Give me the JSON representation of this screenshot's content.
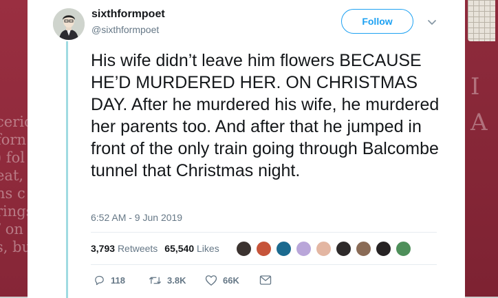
{
  "background": {
    "left_text": "ceric\nforn\n) fol\neat,\nns c\nrings\n/ on\ns, bu",
    "right_text": "I\nA"
  },
  "tweet": {
    "display_name": "sixthformpoet",
    "handle": "@sixthformpoet",
    "follow_label": "Follow",
    "text": "His wife didn’t leave him flowers BECAUSE HE’D MURDERED HER. ON CHRISTMAS DAY. After he murdered his wife, he murdered her parents too. And after that he jumped in front of the only train going through Balcombe tunnel that Christmas night.",
    "timestamp": "6:52 AM - 9 Jun 2019",
    "retweets_count": "3,793",
    "retweets_label": "Retweets",
    "likes_count": "65,540",
    "likes_label": "Likes",
    "replies": "118",
    "retweets_short": "3.8K",
    "likes_short": "66K"
  },
  "colors": {
    "accent": "#1da1f2",
    "thread_line": "#9fdbe1",
    "muted_text": "#657786",
    "liker_avatars": [
      "#3b3330",
      "#c6543a",
      "#1b6a8f",
      "#b9a6d9",
      "#e3b6a2",
      "#2e2a2a",
      "#8a6b56",
      "#262223",
      "#4e8f5a"
    ]
  },
  "icons": [
    "reply-icon",
    "retweet-icon",
    "like-icon",
    "direct-message-icon",
    "chevron-down-icon"
  ]
}
